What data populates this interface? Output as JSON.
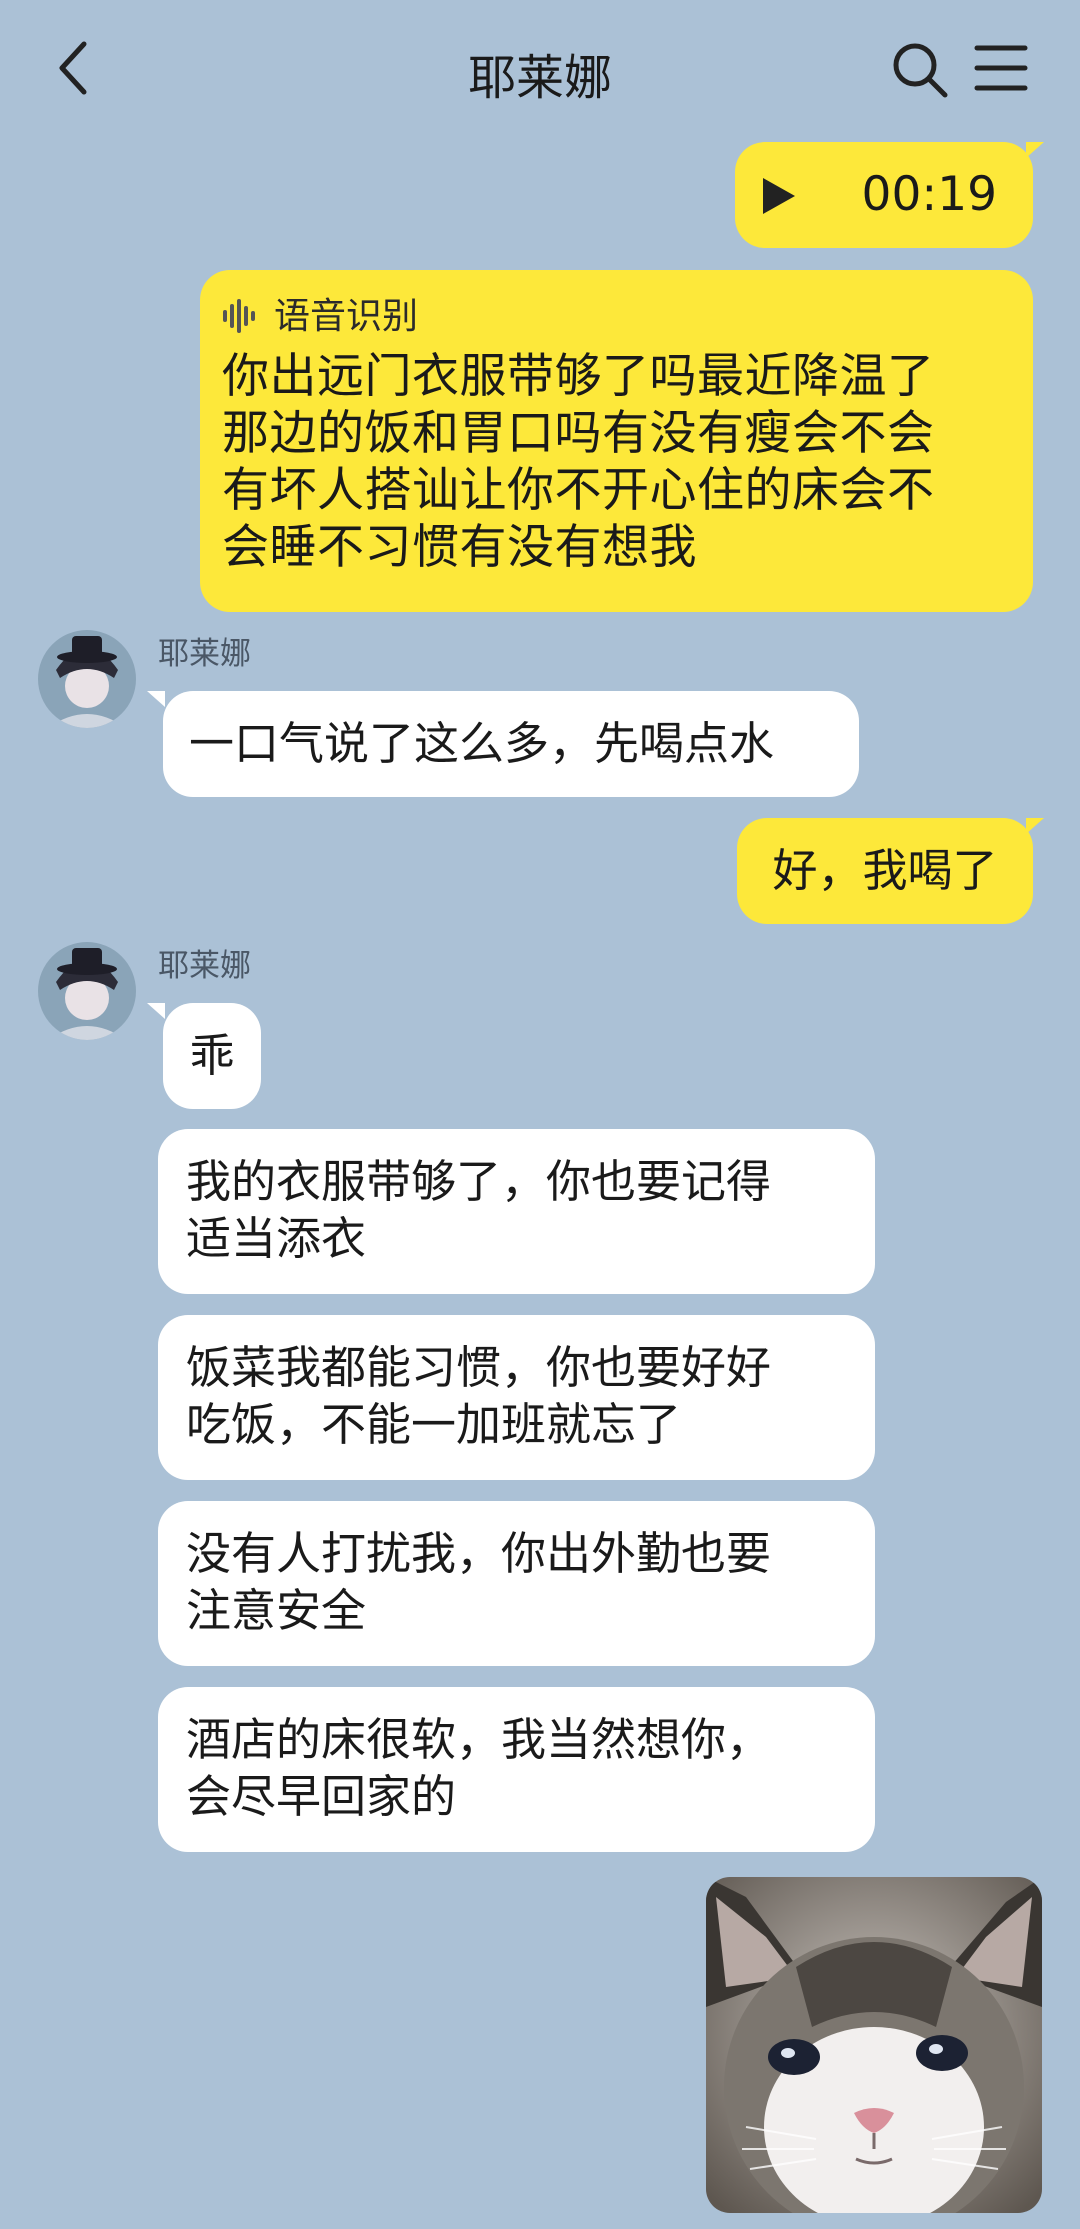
{
  "header": {
    "title": "耶莱娜"
  },
  "colors": {
    "background": "#abc1d6",
    "outgoing_bubble": "#fde83a",
    "incoming_bubble": "#ffffff"
  },
  "icons": [
    "back-arrow-icon",
    "search-icon",
    "menu-icon",
    "play-icon",
    "waveform-icon"
  ],
  "messages": {
    "voice": {
      "duration": "00:19"
    },
    "transcript": {
      "label": "语音识别",
      "lines": [
        "你出远门衣服带够了吗最近降温了",
        "那边的饭和胃口吗有没有瘦会不会",
        "有坏人搭讪让你不开心住的床会不",
        "会睡不习惯有没有想我"
      ]
    },
    "sender_1": {
      "name": "耶莱娜",
      "text": "一口气说了这么多，先喝点水"
    },
    "reply_1": {
      "text": "好，我喝了"
    },
    "sender_2": {
      "name": "耶莱娜",
      "first": "乖",
      "bubbles": [
        [
          "我的衣服带够了，你也要记得",
          "适当添衣"
        ],
        [
          "饭菜我都能习惯，你也要好好",
          "吃饭，不能一加班就忘了"
        ],
        [
          "没有人打扰我，你出外勤也要",
          "注意安全"
        ],
        [
          "酒店的床很软，我当然想你，",
          "会尽早回家的"
        ]
      ]
    }
  }
}
